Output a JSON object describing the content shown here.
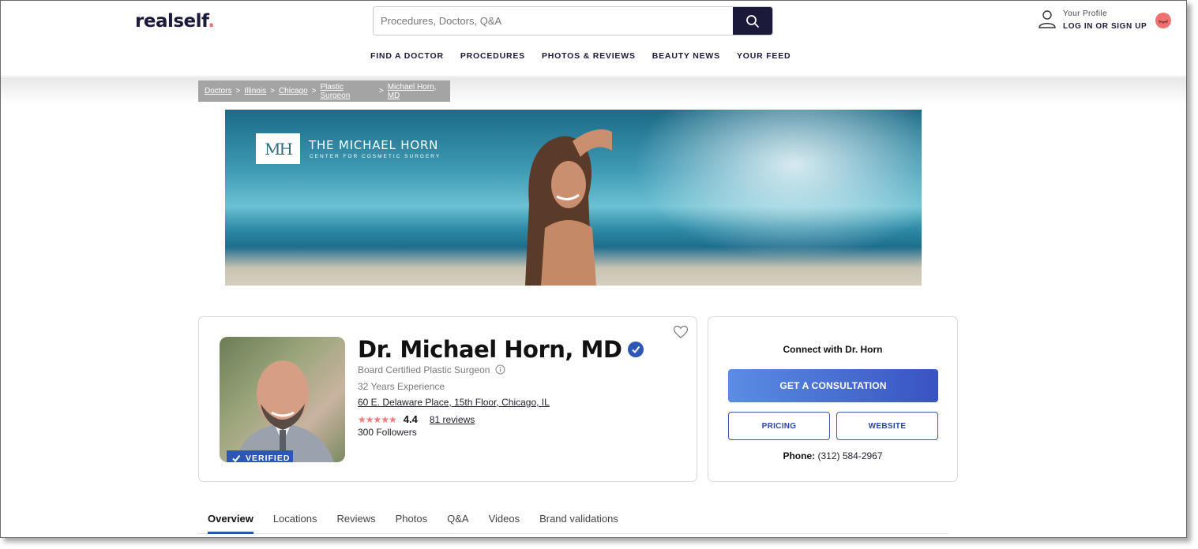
{
  "brand": {
    "name": "realself",
    "dot": "."
  },
  "search": {
    "placeholder": "Procedures, Doctors, Q&A"
  },
  "nav": [
    "FIND A DOCTOR",
    "PROCEDURES",
    "PHOTOS & REVIEWS",
    "BEAUTY NEWS",
    "YOUR FEED"
  ],
  "profile": {
    "label": "Your Profile",
    "action": "LOG IN OR SIGN UP"
  },
  "breadcrumb": [
    "Doctors",
    "Illinois",
    "Chicago",
    "Plastic Surgeon",
    "Michael Horn, MD"
  ],
  "breadcrumb_sep": ">",
  "banner": {
    "logo_initials": "MH",
    "title": "THE MICHAEL HORN",
    "subtitle": "CENTER FOR COSMETIC SURGERY"
  },
  "doctor": {
    "badge": "VERIFIED",
    "name": "Dr. Michael Horn, MD",
    "specialty": "Board Certified Plastic Surgeon",
    "experience": "32 Years Experience",
    "address": "60 E. Delaware Place, 15th Floor, Chicago, IL",
    "rating": "4.4",
    "rating_value": 4.4,
    "reviews": "81 reviews",
    "followers": "300 Followers"
  },
  "connect": {
    "title": "Connect with Dr. Horn",
    "consult_label": "GET A CONSULTATION",
    "pricing_label": "PRICING",
    "website_label": "WEBSITE",
    "phone_label": "Phone:",
    "phone_number": "(312) 584-2967"
  },
  "tabs": [
    "Overview",
    "Locations",
    "Reviews",
    "Photos",
    "Q&A",
    "Videos",
    "Brand validations"
  ],
  "colors": {
    "brand_navy": "#1b1a3a",
    "accent_blue": "#2d56b5",
    "star_pink": "#f07b7b"
  },
  "icons": {
    "search": "search-icon",
    "user": "user-icon",
    "heart": "heart-icon",
    "verified": "verified-check-icon",
    "info": "info-icon"
  }
}
